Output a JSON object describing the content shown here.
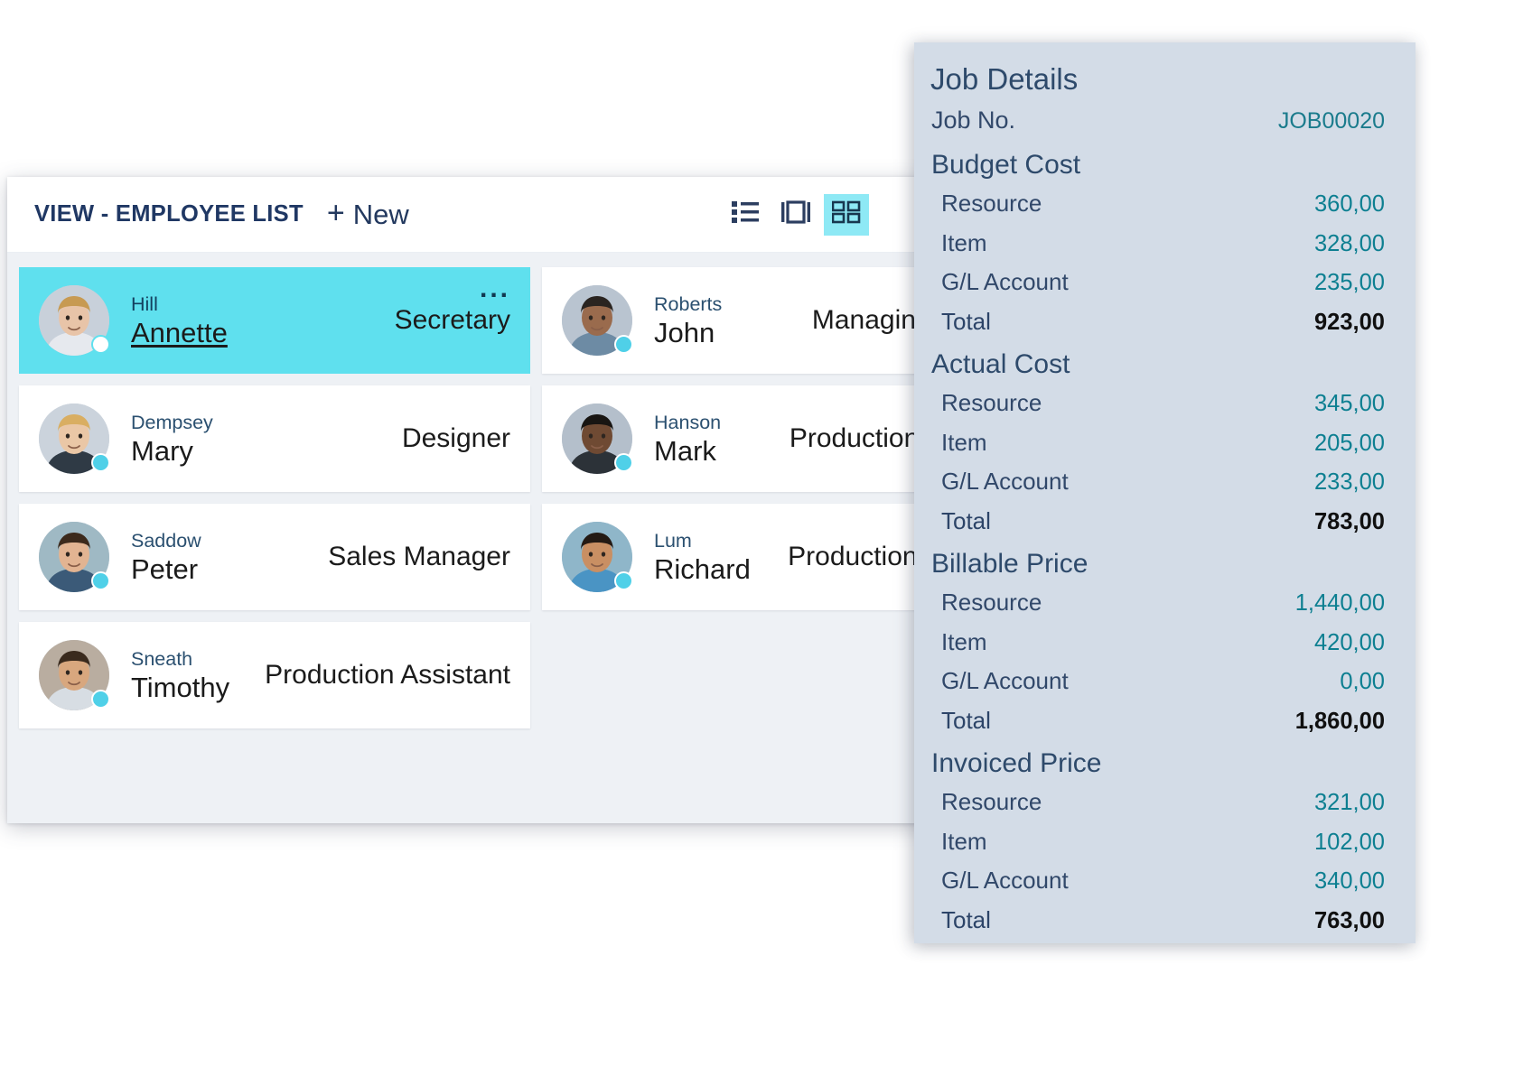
{
  "employee_window": {
    "title": "VIEW - EMPLOYEE LIST",
    "new_button": {
      "plus": "+",
      "label": "New"
    },
    "view_toggles": [
      {
        "name": "list-view",
        "label": "List view",
        "active": false
      },
      {
        "name": "card-view",
        "label": "Card view",
        "active": false
      },
      {
        "name": "tile-view",
        "label": "Tile view",
        "active": true
      }
    ],
    "card_menu_glyph": "...",
    "employees": [
      {
        "last_name": "Hill",
        "first_name": "Annette",
        "job_title": "Secretary",
        "selected": true,
        "column": "left"
      },
      {
        "last_name": "Roberts",
        "first_name": "John",
        "job_title": "Managing Director",
        "selected": false,
        "column": "right"
      },
      {
        "last_name": "Dempsey",
        "first_name": "Mary",
        "job_title": "Designer",
        "selected": false,
        "column": "left"
      },
      {
        "last_name": "Hanson",
        "first_name": "Mark",
        "job_title": "Production Manager",
        "selected": false,
        "column": "right"
      },
      {
        "last_name": "Saddow",
        "first_name": "Peter",
        "job_title": "Sales Manager",
        "selected": false,
        "column": "left"
      },
      {
        "last_name": "Lum",
        "first_name": "Richard",
        "job_title": "Production Assistant",
        "selected": false,
        "column": "right"
      },
      {
        "last_name": "Sneath",
        "first_name": "Timothy",
        "job_title": "Production Assistant",
        "selected": false,
        "column": "left"
      }
    ]
  },
  "job_panel": {
    "title": "Job Details",
    "job_no": {
      "label": "Job No.",
      "value": "JOB00020"
    },
    "sections": [
      {
        "heading": "Budget Cost",
        "rows": [
          {
            "label": "Resource",
            "value": "360,00",
            "total": false
          },
          {
            "label": "Item",
            "value": "328,00",
            "total": false
          },
          {
            "label": "G/L Account",
            "value": "235,00",
            "total": false
          },
          {
            "label": "Total",
            "value": "923,00",
            "total": true
          }
        ]
      },
      {
        "heading": "Actual Cost",
        "rows": [
          {
            "label": "Resource",
            "value": "345,00",
            "total": false
          },
          {
            "label": "Item",
            "value": "205,00",
            "total": false
          },
          {
            "label": "G/L Account",
            "value": "233,00",
            "total": false
          },
          {
            "label": "Total",
            "value": "783,00",
            "total": true
          }
        ]
      },
      {
        "heading": "Billable Price",
        "rows": [
          {
            "label": "Resource",
            "value": "1,440,00",
            "total": false
          },
          {
            "label": "Item",
            "value": "420,00",
            "total": false
          },
          {
            "label": "G/L Account",
            "value": "0,00",
            "total": false
          },
          {
            "label": "Total",
            "value": "1,860,00",
            "total": true
          }
        ]
      },
      {
        "heading": "Invoiced Price",
        "rows": [
          {
            "label": "Resource",
            "value": "321,00",
            "total": false
          },
          {
            "label": "Item",
            "value": "102,00",
            "total": false
          },
          {
            "label": "G/L Account",
            "value": "340,00",
            "total": false
          },
          {
            "label": "Total",
            "value": "763,00",
            "total": true
          }
        ]
      }
    ]
  },
  "colors": {
    "selection_cyan": "#5FE0EE",
    "panel_background": "#d3dce7",
    "accent_teal": "#0d7f91",
    "label_blue": "#31486a",
    "title_navy": "#203864",
    "body_grey": "#eef1f5"
  }
}
